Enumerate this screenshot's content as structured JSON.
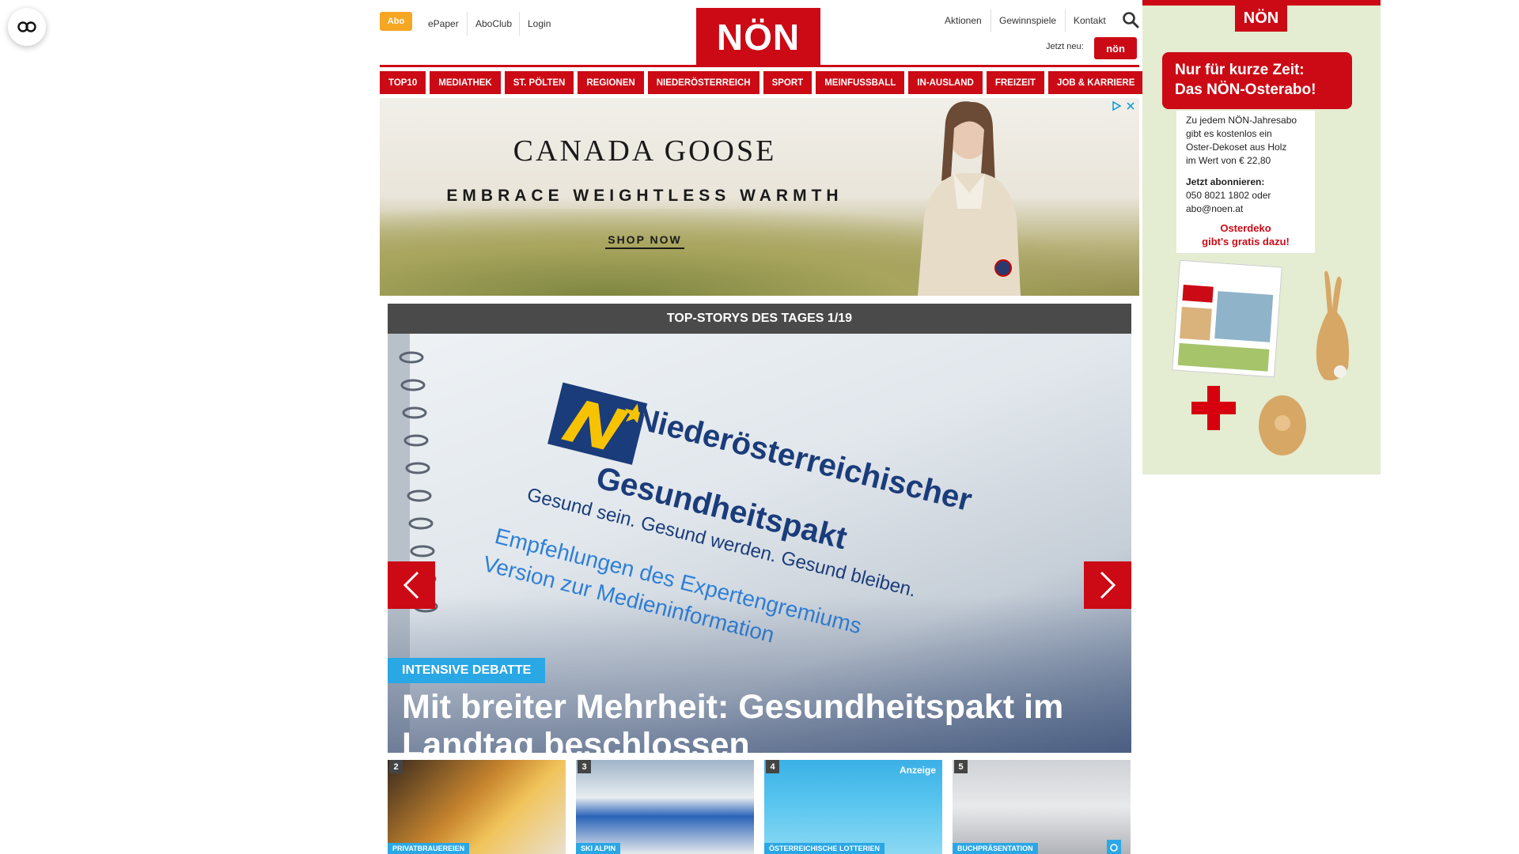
{
  "a11y": {
    "icon": "accessibility-icon"
  },
  "header": {
    "abo_label": "Abo",
    "top_links": [
      "ePaper",
      "AboClub",
      "Login"
    ],
    "logo_text": "NÖN",
    "right_links": [
      "Aktionen",
      "Gewinnspiele",
      "Kontakt"
    ],
    "jetzt_neu": "Jetzt neu:",
    "kleine_logo": "nön",
    "accent_color": "#cc0a15"
  },
  "nav": {
    "items": [
      "TOP10",
      "MEDIATHEK",
      "ST. PÖLTEN",
      "REGIONEN",
      "NIEDERÖSTERREICH",
      "SPORT",
      "MEINFUSSBALL",
      "IN-AUSLAND",
      "FREIZEIT",
      "JOB & KARRIERE"
    ]
  },
  "ad_banner": {
    "brand": "CANADA GOOSE",
    "tagline": "EMBRACE WEIGHTLESS WARMTH",
    "cta": "SHOP NOW"
  },
  "side_ad": {
    "logo": "NÖN",
    "headline_1": "Nur für kurze Zeit:",
    "headline_2": "Das NÖN-Osterabo!",
    "body_1": "Zu jedem NÖN-Jahresabo",
    "body_2": "gibt es kostenlos ein",
    "body_3": "Oster-Dekoset aus Holz",
    "body_4": "im Wert von € 22,80",
    "subscribe_label": "Jetzt abonnieren:",
    "phone": "050 8021 1802 oder",
    "email": "abo@noen.at",
    "promo_1": "Osterdeko",
    "promo_2": "gibt's gratis dazu!"
  },
  "stories": {
    "header": "TOP-STORYS DES TAGES 1/19",
    "hero": {
      "image_text_1": "Niederösterreichischer",
      "image_text_2": "Gesundheitspakt",
      "image_text_3": "Gesund sein. Gesund werden. Gesund bleiben.",
      "image_text_4": "Empfehlungen des Expertengremiums",
      "image_text_5": "Version zur Medieninformation",
      "tag": "INTENSIVE DEBATTE",
      "headline": "Mit breiter Mehrheit: Gesundheitspakt im Landtag beschlossen"
    },
    "thumbs": [
      {
        "num": "2",
        "tag": "PRIVATBRAUEREIEN",
        "extra": ""
      },
      {
        "num": "3",
        "tag": "SKI ALPIN",
        "extra": ""
      },
      {
        "num": "4",
        "tag": "ÖSTERREICHISCHE LOTTERIEN",
        "extra": "Anzeige"
      },
      {
        "num": "5",
        "tag": "BUCHPRÄSENTATION",
        "extra": ""
      }
    ]
  }
}
